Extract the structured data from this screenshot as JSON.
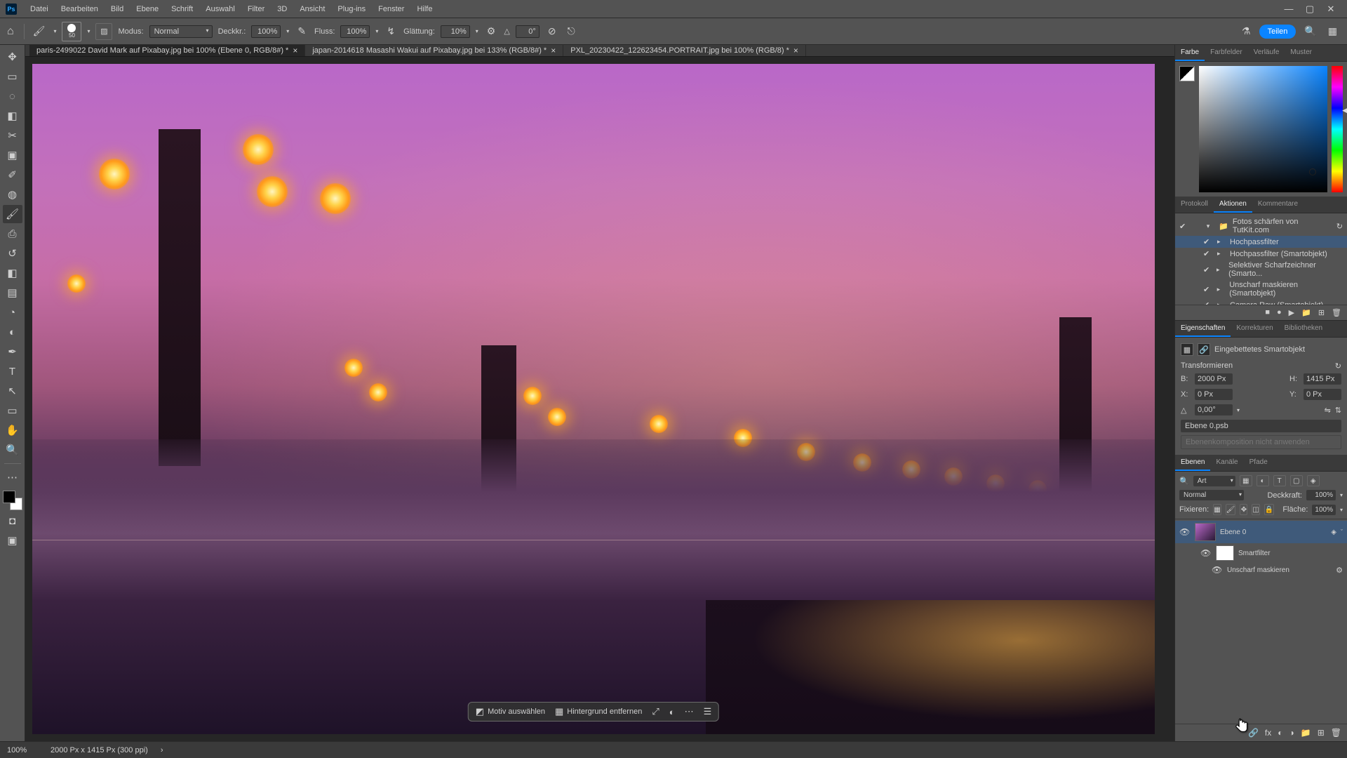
{
  "menu": {
    "items": [
      "Datei",
      "Bearbeiten",
      "Bild",
      "Ebene",
      "Schrift",
      "Auswahl",
      "Filter",
      "3D",
      "Ansicht",
      "Plug-ins",
      "Fenster",
      "Hilfe"
    ]
  },
  "optbar": {
    "brush_size": "50",
    "mode_label": "Modus:",
    "mode_value": "Normal",
    "opacity_label": "Deckkr.:",
    "opacity_value": "100%",
    "flow_label": "Fluss:",
    "flow_value": "100%",
    "smoothing_label": "Glättung:",
    "smoothing_value": "10%",
    "angle_label": "△",
    "angle_value": "0°",
    "share": "Teilen"
  },
  "tabs": [
    {
      "label": "paris-2499022  David Mark auf Pixabay.jpg bei 100% (Ebene 0, RGB/8#) *",
      "active": true
    },
    {
      "label": "japan-2014618 Masashi Wakui auf Pixabay.jpg bei 133% (RGB/8#) *",
      "active": false
    },
    {
      "label": "PXL_20230422_122623454.PORTRAIT.jpg bei 100% (RGB/8) *",
      "active": false
    }
  ],
  "ctx": {
    "select_subject": "Motiv auswählen",
    "remove_bg": "Hintergrund entfernen"
  },
  "status": {
    "zoom": "100%",
    "dims": "2000 Px x 1415 Px (300 ppi)"
  },
  "color_tabs": [
    "Farbe",
    "Farbfelder",
    "Verläufe",
    "Muster"
  ],
  "history_tabs": [
    "Protokoll",
    "Aktionen",
    "Kommentare"
  ],
  "actions": {
    "set": "Fotos schärfen von TutKit.com",
    "items": [
      "Hochpassfilter",
      "Hochpassfilter (Smartobjekt)",
      "Selektiver Scharfzeichner (Smarto...",
      "Unscharf maskieren (Smartobjekt)",
      "Camera Raw (Smartobjekt)"
    ],
    "selected": 0
  },
  "props_tabs": [
    "Eigenschaften",
    "Korrekturen",
    "Bibliotheken"
  ],
  "props": {
    "type": "Eingebettetes Smartobjekt",
    "transform_label": "Transformieren",
    "w_label": "B:",
    "w_value": "2000 Px",
    "h_label": "H:",
    "h_value": "1415 Px",
    "x_label": "X:",
    "x_value": "0 Px",
    "y_label": "Y:",
    "y_value": "0 Px",
    "angle_value": "0,00°",
    "psb": "Ebene 0.psb",
    "comp_disabled": "Ebenenkomposition nicht anwenden"
  },
  "layer_tabs": [
    "Ebenen",
    "Kanäle",
    "Pfade"
  ],
  "layers": {
    "filter_kind": "Art",
    "blend": "Normal",
    "opacity_label": "Deckkraft:",
    "opacity_value": "100%",
    "lock_label": "Fixieren:",
    "fill_label": "Fläche:",
    "fill_value": "100%",
    "layer0": "Ebene 0",
    "smartfilter": "Smartfilter",
    "unsharp": "Unscharf maskieren"
  }
}
